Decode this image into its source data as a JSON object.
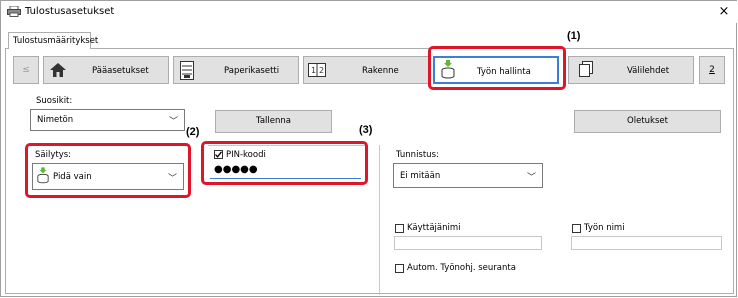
{
  "window": {
    "title": "Tulostusasetukset",
    "close_glyph": "×"
  },
  "tabs": [
    {
      "label": "Tulostusmääritykset"
    }
  ],
  "nav": {
    "prev_glyph": "≤",
    "next_label": "2",
    "buttons": [
      {
        "label": "Pääasetukset",
        "icon": "house-icon"
      },
      {
        "label": "Paperikasetti",
        "icon": "paper-tray-icon"
      },
      {
        "label": "Rakenne",
        "icon": "layout-icon"
      },
      {
        "label": "Työn hallinta",
        "icon": "job-storage-icon",
        "active": true
      },
      {
        "label": "Välilehdet",
        "icon": "tabs-icon"
      }
    ]
  },
  "favorites": {
    "label": "Suosikit:",
    "value": "Nimetön",
    "save_label": "Tallenna",
    "defaults_label": "Oletukset"
  },
  "storage": {
    "label": "Säilytys:",
    "value": "Pidä vain"
  },
  "pin": {
    "checkbox_label": "PIN-koodi",
    "checked": true,
    "value": "●●●●●"
  },
  "identification": {
    "label": "Tunnistus:",
    "value": "Ei mitään"
  },
  "username": {
    "label": "Käyttäjänimi",
    "checked": false,
    "value": ""
  },
  "jobname": {
    "label": "Työn nimi",
    "checked": false,
    "value": ""
  },
  "auto_tracking": {
    "label": "Autom. Työnohj. seuranta",
    "checked": false
  },
  "callouts": [
    {
      "label": "(1)"
    },
    {
      "label": "(2)"
    },
    {
      "label": "(3)"
    }
  ],
  "colors": {
    "callout": "#e0152a",
    "active_border": "#3c7fd6",
    "button_bg": "#e1e1e1"
  }
}
